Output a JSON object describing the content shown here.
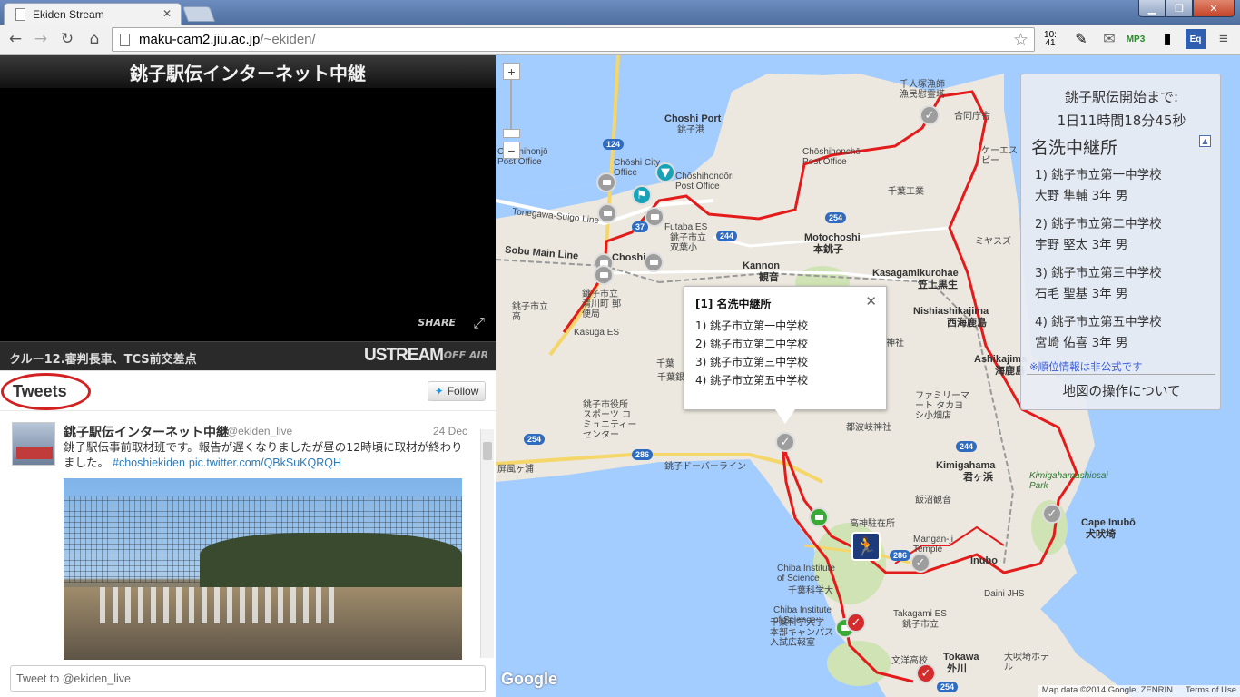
{
  "browser": {
    "tab_title": "Ekiden Stream",
    "tab_close": "✕",
    "url_host": "maku-cam2.jiu.ac.jp",
    "url_path": "/~ekiden/",
    "clock_line1": "10:",
    "clock_line2": "41",
    "ext_mp3": "MP3",
    "ext_eq": "Eq"
  },
  "video": {
    "title": "銚子駅伝インターネット中継",
    "share_label": "SHARE",
    "caption": "クルー12.審判長車、TCS前交差点",
    "brand": "USTREAM",
    "status": "OFF AIR"
  },
  "tweets": {
    "title": "Tweets",
    "follow_label": "Follow",
    "author_name": "銚子駅伝インターネット中継",
    "author_handle": "@ekiden_live",
    "date": "24 Dec",
    "text": "銚子駅伝事前取材班です。報告が遅くなりましたが昼の12時頃に取材が終わりました。",
    "hashtag": "#choshiekiden",
    "link": "pic.twitter.com/QBkSuKQRQH",
    "compose_placeholder": "Tweet to @ekiden_live"
  },
  "map": {
    "zoom_in": "+",
    "zoom_out": "−",
    "labels": {
      "choshi_port_en": "Choshi Port",
      "choshi_port_ja": "銚子港",
      "choshi_city_office_en": "Chōshi City Office",
      "chosh_post_en": "Chōshihondōri Post Office",
      "choshi_hon_en": "Chōshihonjō Post Office",
      "choshihoncho_en": "Chōshihonchō Post Office",
      "futaba_en": "Futaba ES",
      "motochoshi_en": "Motochoshi",
      "motochoshi_ja": "本銚子",
      "kannon_en": "Kannon",
      "kannon_ja": "観音",
      "kasagami_en": "Kasagamikurohae",
      "kasagami_ja": "笠上黒生",
      "nishiashi_en": "Nishiashikajima",
      "nishiashi_ja": "西海鹿島",
      "ashikajima_en": "Ashikajima",
      "ashikajima_ja": "海鹿島",
      "kimigahama_en": "Kimigahama",
      "kimigahama_ja": "君ヶ浜",
      "kimiga_park_en": "Kimigahamashiosai Park",
      "cape_en": "Cape Inubō",
      "cape_ja": "犬吠埼",
      "inubo_en": "Inubo",
      "manganji_en": "Mangan-ji Temple",
      "chiba_inst_en": "Chiba Institute of Science",
      "chiba_inst_ja": "千葉科学大",
      "takagami_en": "Takagami ES",
      "takagami_ja": "銚子市立",
      "tokawa_en": "Tokawa",
      "tokawa_ja": "外川",
      "kasuga_en": "Kasuga ES",
      "sobu_en": "Sobu Main Line",
      "tonegawa_en": "Tonegawa-Suigo Line",
      "choshi_station_en": "Choshi",
      "choshi_dover": "銚子ドーバーライン",
      "byobugaura": "屏風ヶ浦",
      "tougi": "都波岐神社",
      "inada": "稲生神社",
      "family_mart": "ファミリーマート タカヨシ小畑店",
      "kosaka_office": "銚子市役所 スポーツ コミュニティー センター",
      "iizawa": "飯沼観音",
      "chiba_bank": "千葉銀行",
      "senninzuka": "千人塚漁師 漁民慰霊塔",
      "aido": "合同庁舎",
      "keihin": "ケーエスピー",
      "mikasa": "ミヤスズ",
      "chiba_kogyo": "千葉工業",
      "ichi_high": "銚子市立高",
      "ichi_kanuma": "銚子市立 双葉小",
      "ichi_seiryo": "銚子市立 清川町 郵便局",
      "takagami_station": "高神駐在所",
      "daini": "Daini JHS",
      "ooshio": "大吠埼ホテル",
      "chiba_campus": "千葉科学大学 本部キャンパス 入試広報室",
      "bunyo": "文洋高校",
      "chiba_choshi": "千葉"
    },
    "routes": [
      "124",
      "37",
      "244",
      "254",
      "254",
      "286",
      "286",
      "244",
      "254"
    ],
    "info_window": {
      "title": "[1] 名洗中継所",
      "items": [
        "1) 銚子市立第一中学校",
        "2) 銚子市立第二中学校",
        "3) 銚子市立第三中学校",
        "4) 銚子市立第五中学校"
      ],
      "close": "✕"
    },
    "panel": {
      "countdown_label": "銚子駅伝開始まで:",
      "countdown_value": "1日11時間18分45秒",
      "station": "名洗中継所",
      "collapse": "▲",
      "entries": [
        {
          "school": "1) 銚子市立第一中学校",
          "runner": "大野 隼輔 3年 男"
        },
        {
          "school": "2) 銚子市立第二中学校",
          "runner": "宇野 堅太 3年 男"
        },
        {
          "school": "3) 銚子市立第三中学校",
          "runner": "石毛 聖基 3年 男"
        },
        {
          "school": "4) 銚子市立第五中学校",
          "runner": "宮崎 佑喜 3年 男"
        }
      ],
      "disclaimer": "※順位情報は非公式です",
      "help": "地図の操作について"
    },
    "google": "Google",
    "attribution": "Map data ©2014 Google, ZENRIN",
    "terms": "Terms of Use"
  }
}
